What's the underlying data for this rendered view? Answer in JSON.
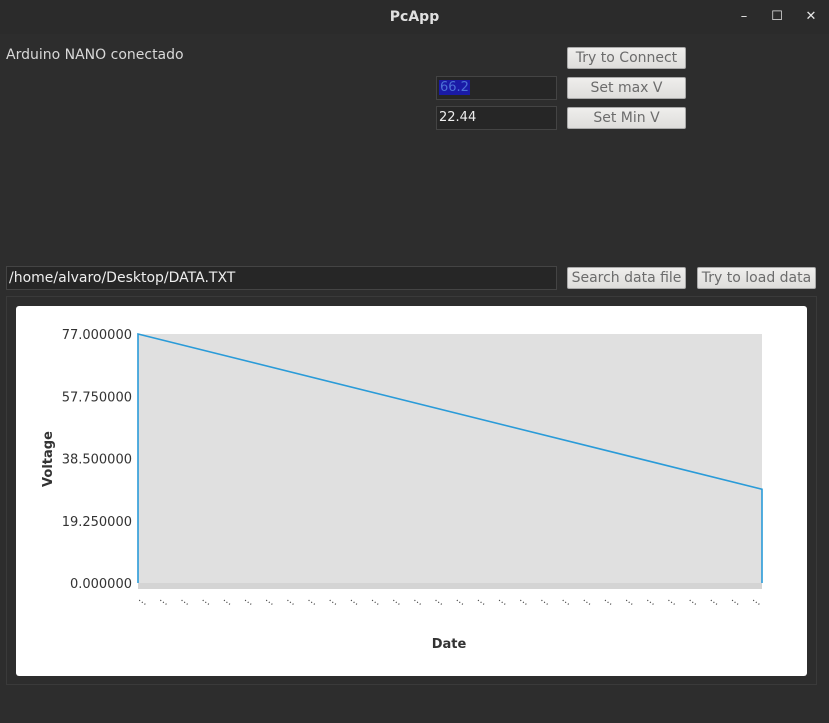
{
  "window": {
    "title": "PcApp",
    "minimize_glyph": "–",
    "maximize_glyph": "☐",
    "close_glyph": "✕"
  },
  "status_text": "Arduino NANO conectado",
  "controls": {
    "connect_label": "Try to Connect",
    "max_value": "66.2",
    "set_max_label": "Set max V",
    "min_value": "22.44",
    "set_min_label": "Set Min V"
  },
  "file": {
    "path": "/home/alvaro/Desktop/DATA.TXT",
    "search_label": "Search data file",
    "load_label": "Try to load data"
  },
  "colors": {
    "plot_background": "#e0e0e0",
    "series_line": "#2a9bd8"
  },
  "chart_data": {
    "type": "line",
    "xlabel": "Date",
    "ylabel": "Voltage",
    "ylim": [
      0,
      77
    ],
    "yticks": [
      "77.000000",
      "57.750000",
      "38.500000",
      "19.250000",
      "0.000000"
    ],
    "x_tick_count": 30,
    "x_tick_label": "...",
    "series": [
      {
        "points": [
          [
            0,
            0
          ],
          [
            0,
            77
          ],
          [
            1,
            29
          ],
          [
            1,
            0
          ]
        ]
      }
    ]
  }
}
